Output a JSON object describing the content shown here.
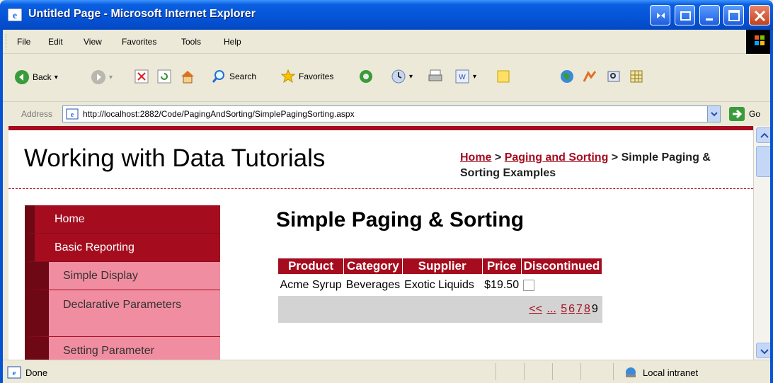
{
  "window": {
    "title": "Untitled Page - Microsoft Internet Explorer"
  },
  "menu": {
    "items": [
      "File",
      "Edit",
      "View",
      "Favorites",
      "Tools",
      "Help"
    ]
  },
  "toolbar": {
    "back_label": "Back",
    "search_label": "Search",
    "favorites_label": "Favorites"
  },
  "address": {
    "label": "Address",
    "url": "http://localhost:2882/Code/PagingAndSorting/SimplePagingSorting.aspx",
    "go_label": "Go"
  },
  "page": {
    "site_title": "Working with Data Tutorials",
    "breadcrumb": {
      "home": "Home",
      "sep1": " > ",
      "section": "Paging and Sorting",
      "sep2": " > ",
      "current": "Simple Paging & Sorting Examples"
    },
    "left_menu": {
      "items": [
        "Home",
        "Basic Reporting"
      ],
      "sub_items": [
        "Simple Display",
        "Declarative Parameters",
        "Setting Parameter"
      ]
    },
    "heading": "Simple Paging & Sorting",
    "grid": {
      "columns": [
        "Product",
        "Category",
        "Supplier",
        "Price",
        "Discontinued"
      ],
      "rows": [
        {
          "product": "Acme Syrup",
          "category": "Beverages",
          "supplier": "Exotic Liquids",
          "price": "$19.50",
          "discontinued": false
        }
      ],
      "pager": {
        "first": "<<",
        "prev_ellipsis": "...",
        "pages": [
          "5",
          "6",
          "7",
          "8"
        ],
        "current": "9"
      }
    }
  },
  "status": {
    "text": "Done",
    "zone": "Local intranet"
  },
  "colors": {
    "brand": "#a50d1f",
    "submenu": "#f18da0",
    "titlebar": "#0553d6"
  }
}
